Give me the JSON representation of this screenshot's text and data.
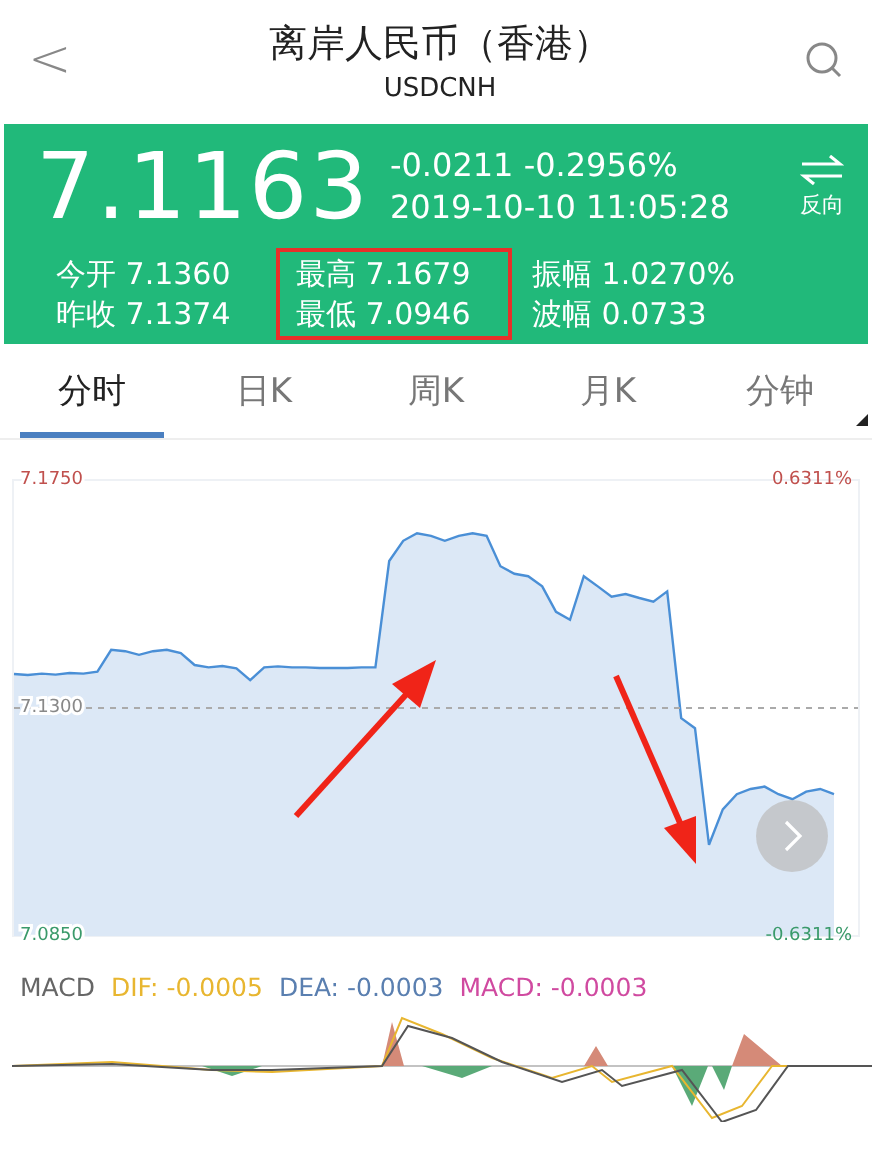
{
  "header": {
    "back": "<",
    "title": "离岸人民币（香港）",
    "subtitle": "USDCNH"
  },
  "quote": {
    "price": "7.1163",
    "change": "-0.0211 -0.2956%",
    "time": "2019-10-10 11:05:28",
    "swap_label": "反向",
    "stats": [
      {
        "label": "今开",
        "value": "7.1360",
        "highlighted": false
      },
      {
        "label": "昨收",
        "value": "7.1374",
        "highlighted": false
      },
      {
        "label": "最高",
        "value": "7.1679",
        "highlighted": true
      },
      {
        "label": "最低",
        "value": "7.0946",
        "highlighted": true
      },
      {
        "label": "振幅",
        "value": "1.0270%",
        "highlighted": false
      },
      {
        "label": "波幅",
        "value": "0.0733",
        "highlighted": false
      }
    ]
  },
  "tabs": [
    {
      "label": "分时",
      "selected": true
    },
    {
      "label": "日K",
      "selected": false
    },
    {
      "label": "周K",
      "selected": false
    },
    {
      "label": "月K",
      "selected": false
    },
    {
      "label": "分钟",
      "selected": false
    }
  ],
  "intraday": {
    "right_labels": [
      "0.6311%",
      "-0.6311%"
    ],
    "chart_data": {
      "type": "area",
      "ylim": [
        7.085,
        7.175
      ],
      "yticks": [
        {
          "value": 7.175,
          "label": "7.1750"
        },
        {
          "value": 7.13,
          "label": "7.1300"
        },
        {
          "value": 7.085,
          "label": "7.0850"
        }
      ],
      "values": [
        7.1367,
        7.1365,
        7.1368,
        7.1366,
        7.1369,
        7.1368,
        7.1372,
        7.1415,
        7.1412,
        7.1405,
        7.1412,
        7.1415,
        7.1408,
        7.1385,
        7.138,
        7.1383,
        7.1378,
        7.1355,
        7.138,
        7.1382,
        7.138,
        7.138,
        7.1379,
        7.1379,
        7.1379,
        7.138,
        7.138,
        7.159,
        7.163,
        7.1645,
        7.164,
        7.163,
        7.164,
        7.1645,
        7.164,
        7.158,
        7.1565,
        7.156,
        7.154,
        7.149,
        7.1474,
        7.156,
        7.154,
        7.152,
        7.1525,
        7.1517,
        7.151,
        7.153,
        7.128,
        7.126,
        7.103,
        7.11,
        7.113,
        7.114,
        7.1145,
        7.113,
        7.112,
        7.1135,
        7.114,
        7.113
      ]
    }
  },
  "macd": {
    "name": "MACD",
    "dif": "DIF: -0.0005",
    "dea": "DEA: -0.0003",
    "macd": "MACD: -0.0003"
  }
}
